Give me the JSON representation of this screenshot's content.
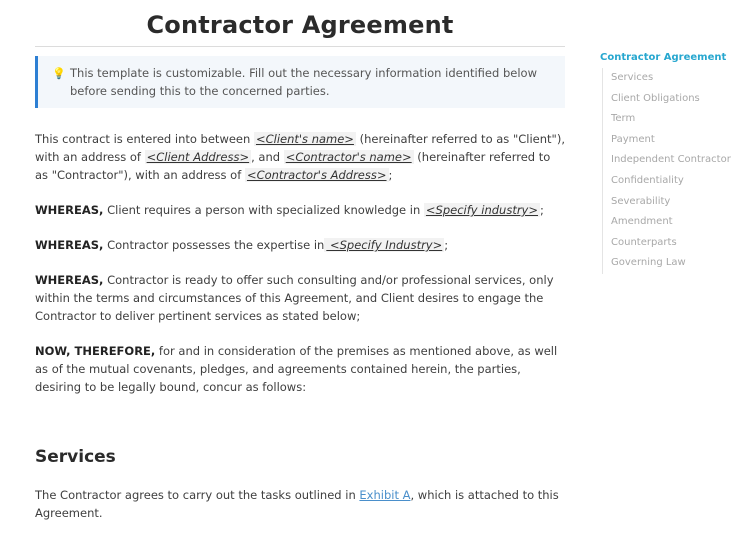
{
  "document": {
    "title": "Contractor Agreement",
    "callout": {
      "icon": "lightbulb-icon",
      "text": "This template is customizable. Fill out the necessary information identified below before sending this to the concerned parties."
    },
    "intro": {
      "t1": "This contract is entered into between ",
      "ph1": "<Client's name>",
      "t2": " (hereinafter referred to as \"Client\"), with an address of ",
      "ph2": "<Client Address>",
      "t3": ", and ",
      "ph3": "<Contractor's name>",
      "t4": " (hereinafter referred to as \"Contractor\"), with an address of ",
      "ph4": "<Contractor's Address>",
      "t5": ";"
    },
    "whereas1": {
      "lead": "WHEREAS,",
      "text": " Client requires a person with specialized knowledge in ",
      "ph": "<Specify industry>",
      "end": ";"
    },
    "whereas2": {
      "lead": "WHEREAS,",
      "text": " Contractor possesses the expertise in",
      "ph": " <Specify Industry>",
      "end": ";"
    },
    "whereas3": {
      "lead": "WHEREAS,",
      "text": " Contractor is ready to offer such consulting and/or professional services, only within the terms and circumstances of this Agreement, and Client desires to engage the Contractor to deliver pertinent services as stated below;"
    },
    "therefore": {
      "lead": "NOW, THEREFORE,",
      "text": " for and in consideration of the premises as mentioned above, as well as of the mutual covenants, pledges, and agreements contained herein, the parties, desiring to be legally bound, concur as follows:"
    },
    "services": {
      "heading": "Services",
      "t1": "The Contractor agrees to carry out the tasks outlined in ",
      "link": "Exhibit A",
      "t2": ", which is attached to this Agreement."
    }
  },
  "toc": {
    "title": "Contractor Agreement",
    "items": [
      "Services",
      "Client Obligations",
      "Term",
      "Payment",
      "Independent Contractor",
      "Confidentiality",
      "Severability",
      "Amendment",
      "Counterparts",
      "Governing Law"
    ]
  }
}
